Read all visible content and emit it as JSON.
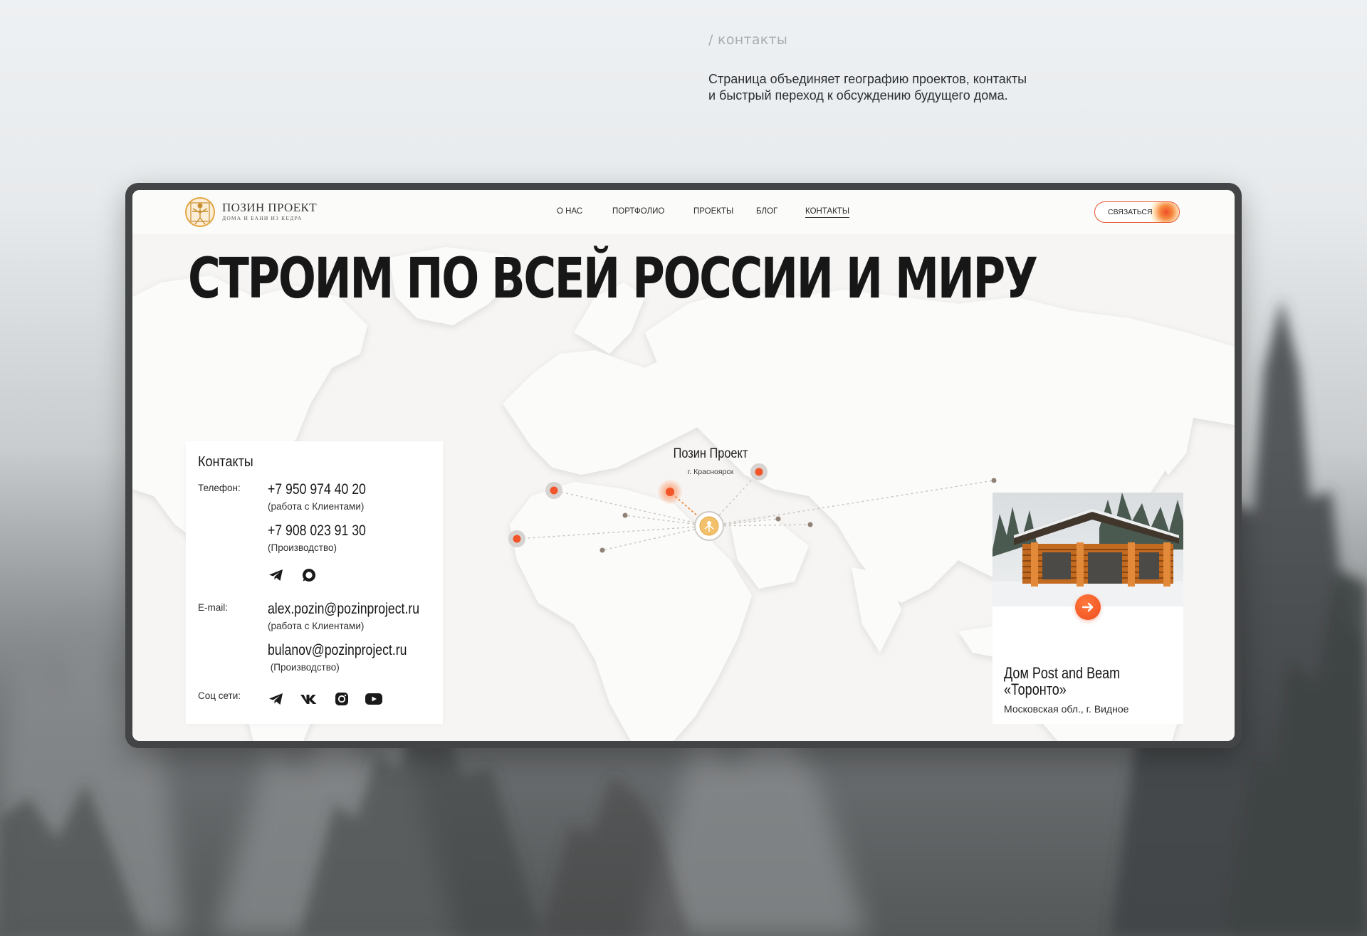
{
  "page": {
    "section_label": "/ контакты",
    "description_lines": [
      "Страница объединяет географию проектов, контакты",
      "и быстрый переход к обсуждению будущего дома."
    ]
  },
  "site": {
    "logo": {
      "title": "ПОЗИН ПРОЕКТ",
      "subtitle": "ДОМА И БАНИ ИЗ КЕДРА"
    },
    "nav": [
      {
        "label": "О НАС"
      },
      {
        "label": "ПОРТФОЛИО"
      },
      {
        "label": "ПРОЕКТЫ"
      },
      {
        "label": "БЛОГ"
      },
      {
        "label": "КОНТАКТЫ",
        "active": true
      }
    ],
    "cta_label": "СВЯЗАТЬСЯ",
    "accent_color": "#ee5226"
  },
  "hero": {
    "title": "СТРОИМ ПО ВСЕЙ РОССИИ И МИРУ"
  },
  "map": {
    "hq": {
      "name": "Позин Проект",
      "city": "г. Красноярск"
    }
  },
  "contacts": {
    "title": "Контакты",
    "phone_label": "Телефон:",
    "phones": [
      {
        "number": "+7 950 974 40 20",
        "note": "(работа с Клиентами)"
      },
      {
        "number": "+7 908 023 91 30",
        "note": "(Производство)"
      }
    ],
    "messenger_icons": [
      "telegram-icon",
      "whatsapp-icon"
    ],
    "email_label": "E-mail:",
    "emails": [
      {
        "address": "alex.pozin@pozinproject.ru",
        "note": "(работа с Клиентами)"
      },
      {
        "address": "bulanov@pozinproject.ru",
        "note": " (Производство)"
      }
    ],
    "social_label": "Соц сети:",
    "social_icons": [
      "telegram-icon",
      "vk-icon",
      "instagram-icon",
      "youtube-icon"
    ]
  },
  "project_card": {
    "title_lines": [
      "Дом Post and Beam",
      "«Торонто»"
    ],
    "location": "Московская обл., г. Видное"
  }
}
